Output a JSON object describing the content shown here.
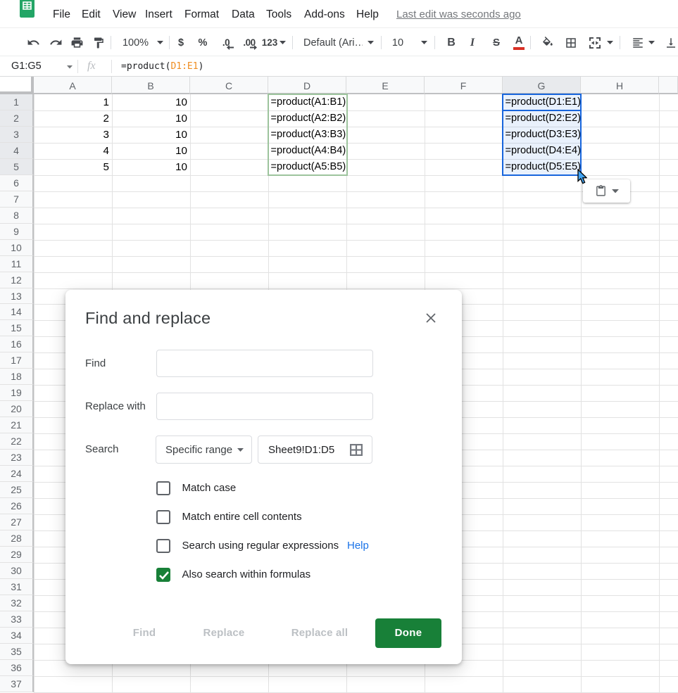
{
  "menu_bar": {
    "items": [
      {
        "label": "File"
      },
      {
        "label": "Edit"
      },
      {
        "label": "View"
      },
      {
        "label": "Insert"
      },
      {
        "label": "Format"
      },
      {
        "label": "Data"
      },
      {
        "label": "Tools"
      },
      {
        "label": "Add-ons"
      },
      {
        "label": "Help"
      }
    ],
    "last_edit_status": "Last edit was seconds ago"
  },
  "toolbar": {
    "zoom_value": "100%",
    "currency_label": "$",
    "percent_label": "%",
    "decrease_decimal_label": ".0",
    "increase_decimal_label": ".00",
    "more_formats_label": "123",
    "font_family_value": "Default (Ari…",
    "font_size_value": "10",
    "bold_label": "B",
    "italic_label": "I",
    "strikethrough_label": "S",
    "text_color_label": "A"
  },
  "formula_bar": {
    "name_box_value": "G1:G5",
    "fx_label": "fx",
    "formula_prefix": "=product(",
    "formula_range": "D1:E1",
    "formula_suffix": ")"
  },
  "grid": {
    "column_headers": [
      "A",
      "B",
      "C",
      "D",
      "E",
      "F",
      "G",
      "H"
    ],
    "visible_row_count": 37,
    "selected_column": "G",
    "selected_row_start": 1,
    "selected_row_end": 5,
    "cells": [
      {
        "ref": "A1",
        "col": 0,
        "row": 1,
        "text": "1",
        "align": "right"
      },
      {
        "ref": "A2",
        "col": 0,
        "row": 2,
        "text": "2",
        "align": "right"
      },
      {
        "ref": "A3",
        "col": 0,
        "row": 3,
        "text": "3",
        "align": "right"
      },
      {
        "ref": "A4",
        "col": 0,
        "row": 4,
        "text": "4",
        "align": "right"
      },
      {
        "ref": "A5",
        "col": 0,
        "row": 5,
        "text": "5",
        "align": "right"
      },
      {
        "ref": "B1",
        "col": 1,
        "row": 1,
        "text": "10",
        "align": "right"
      },
      {
        "ref": "B2",
        "col": 1,
        "row": 2,
        "text": "10",
        "align": "right"
      },
      {
        "ref": "B3",
        "col": 1,
        "row": 3,
        "text": "10",
        "align": "right"
      },
      {
        "ref": "B4",
        "col": 1,
        "row": 4,
        "text": "10",
        "align": "right"
      },
      {
        "ref": "B5",
        "col": 1,
        "row": 5,
        "text": "10",
        "align": "right"
      },
      {
        "ref": "D1",
        "col": 3,
        "row": 1,
        "text": "=product(A1:B1)",
        "align": "left"
      },
      {
        "ref": "D2",
        "col": 3,
        "row": 2,
        "text": "=product(A2:B2)",
        "align": "left"
      },
      {
        "ref": "D3",
        "col": 3,
        "row": 3,
        "text": "=product(A3:B3)",
        "align": "left"
      },
      {
        "ref": "D4",
        "col": 3,
        "row": 4,
        "text": "=product(A4:B4)",
        "align": "left"
      },
      {
        "ref": "D5",
        "col": 3,
        "row": 5,
        "text": "=product(A5:B5)",
        "align": "left"
      },
      {
        "ref": "G1",
        "col": 6,
        "row": 1,
        "text": "=product(D1:E1)",
        "align": "left"
      },
      {
        "ref": "G2",
        "col": 6,
        "row": 2,
        "text": "=product(D2:E2)",
        "align": "left"
      },
      {
        "ref": "G3",
        "col": 6,
        "row": 3,
        "text": "=product(D3:E3)",
        "align": "left"
      },
      {
        "ref": "G4",
        "col": 6,
        "row": 4,
        "text": "=product(D4:E4)",
        "align": "left"
      },
      {
        "ref": "G5",
        "col": 6,
        "row": 5,
        "text": "=product(D5:E5)",
        "align": "left"
      }
    ],
    "search_range_ref": "D1:D5",
    "selection_ref": "G1:G5",
    "active_cell": "G1"
  },
  "dialog": {
    "title": "Find and replace",
    "find_field": {
      "label": "Find",
      "value": ""
    },
    "replace_field": {
      "label": "Replace with",
      "value": ""
    },
    "search_row": {
      "label": "Search",
      "dropdown_value": "Specific range",
      "range_value": "Sheet9!D1:D5"
    },
    "checkboxes": [
      {
        "label": "Match case",
        "checked": false
      },
      {
        "label": "Match entire cell contents",
        "checked": false
      },
      {
        "label": "Search using regular expressions",
        "checked": false,
        "help_label": "Help"
      },
      {
        "label": "Also search within formulas",
        "checked": true
      }
    ],
    "buttons": {
      "find": "Find",
      "replace": "Replace",
      "replace_all": "Replace all",
      "done": "Done"
    }
  },
  "colors": {
    "primary_green": "#188038",
    "selection_blue": "#1765dc",
    "search_range_green": "#9dc49d",
    "link_blue": "#1a73e8",
    "formula_range_orange": "#ef8c1f"
  }
}
